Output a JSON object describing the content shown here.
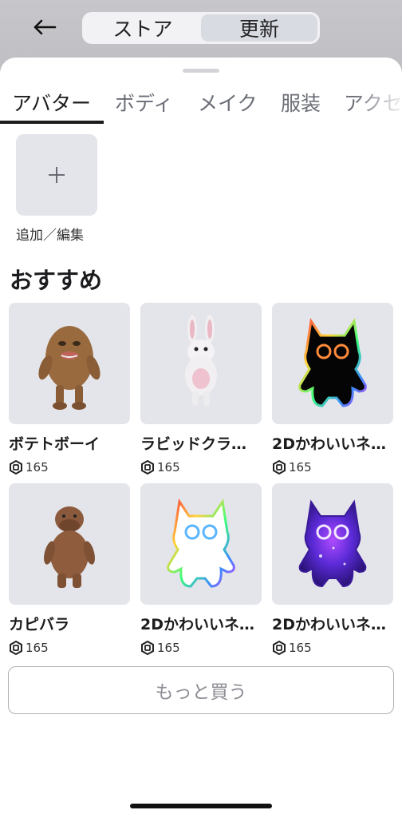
{
  "header": {
    "segments": [
      {
        "label": "ストア"
      },
      {
        "label": "更新"
      }
    ]
  },
  "tabs": [
    {
      "label": "アバター"
    },
    {
      "label": "ボディ"
    },
    {
      "label": "メイク"
    },
    {
      "label": "服装"
    },
    {
      "label": "アクセ"
    }
  ],
  "add_edit": {
    "label": "追加／編集"
  },
  "recommended": {
    "title": "おすすめ",
    "items": [
      {
        "name": "ボテトボーイ",
        "price": "165"
      },
      {
        "name": "ラビッドクラ…",
        "price": "165"
      },
      {
        "name": "2Dかわいいネ…",
        "price": "165"
      },
      {
        "name": "カピバラ",
        "price": "165"
      },
      {
        "name": "2Dかわいいネ…",
        "price": "165"
      },
      {
        "name": "2Dかわいいネ…",
        "price": "165"
      }
    ]
  },
  "more_button": {
    "label": "もっと買う"
  },
  "colors": {
    "sheet": "#ffffff",
    "tile": "#e4e5ea",
    "active_segment": "#d9dbe2"
  }
}
